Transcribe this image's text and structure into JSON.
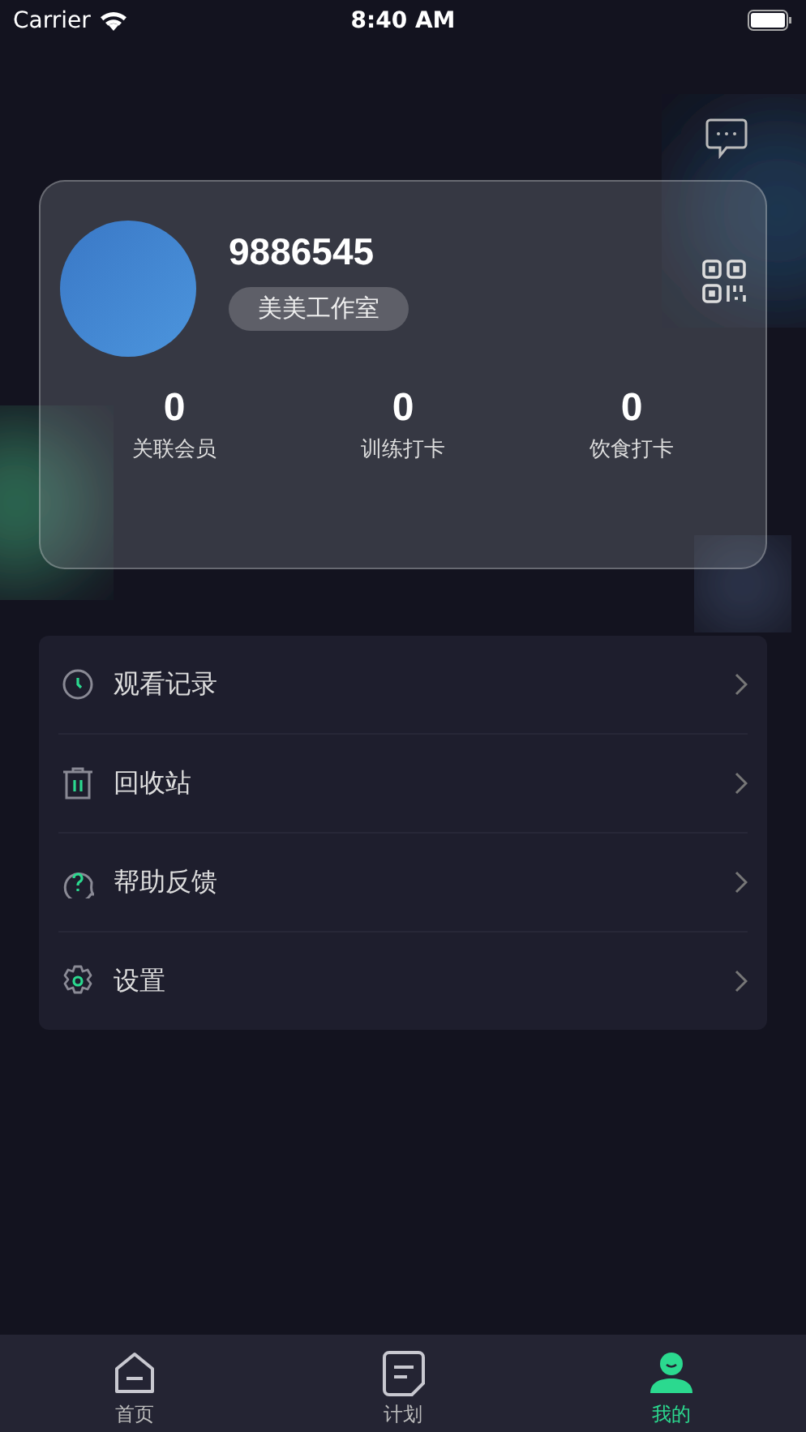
{
  "status_bar": {
    "carrier": "Carrier",
    "time": "8:40 AM"
  },
  "profile": {
    "user_id": "9886545",
    "studio": "美美工作室",
    "stats": [
      {
        "value": "0",
        "label": "关联会员"
      },
      {
        "value": "0",
        "label": "训练打卡"
      },
      {
        "value": "0",
        "label": "饮食打卡"
      }
    ]
  },
  "menu": [
    {
      "kind": "history",
      "label": "观看记录"
    },
    {
      "kind": "trash",
      "label": "回收站"
    },
    {
      "kind": "help",
      "label": "帮助反馈"
    },
    {
      "kind": "settings",
      "label": "设置"
    }
  ],
  "tab_bar": [
    {
      "kind": "home",
      "label": "首页",
      "selected": false
    },
    {
      "kind": "plan",
      "label": "计划",
      "selected": false
    },
    {
      "kind": "mine",
      "label": "我的",
      "selected": true
    }
  ]
}
